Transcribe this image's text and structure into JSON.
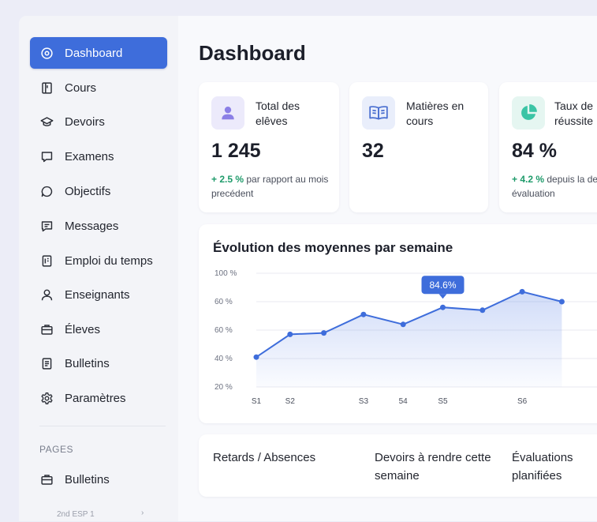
{
  "sidebar": {
    "items": [
      {
        "label": "Dashboard",
        "icon": "target-icon",
        "active": true
      },
      {
        "label": "Cours",
        "icon": "book-icon"
      },
      {
        "label": "Devoirs",
        "icon": "graduation-cap-icon"
      },
      {
        "label": "Examens",
        "icon": "chat-square-icon"
      },
      {
        "label": "Objectifs",
        "icon": "chat-bubble-icon"
      },
      {
        "label": "Messages",
        "icon": "message-icon"
      },
      {
        "label": "Emploi du temps",
        "icon": "calendar-doc-icon"
      },
      {
        "label": "Enseignants",
        "icon": "user-icon"
      },
      {
        "label": "Éleves",
        "icon": "briefcase-icon"
      },
      {
        "label": "Bulletins",
        "icon": "document-icon"
      },
      {
        "label": "Paramètres",
        "icon": "gear-icon"
      }
    ],
    "section_label": "PAGES",
    "section_items": [
      {
        "label": "Bulletins",
        "icon": "briefcase-icon"
      }
    ],
    "footer_text": "2nd ESP 1",
    "footer_chevron": "›",
    "accent": "#3e6ddb"
  },
  "main": {
    "title": "Dashboard",
    "stats": [
      {
        "label": "Total des elêves",
        "value": "1 245",
        "delta": "+ 2.5 %",
        "note": " par rapport au mois precédent",
        "icon": "user-icon",
        "icon_bg": "#eceafb",
        "icon_color": "#8b7fe6"
      },
      {
        "label": "Matières en cours",
        "value": "32",
        "delta": "",
        "note": "",
        "icon": "open-book-icon",
        "icon_bg": "#e9eefb",
        "icon_color": "#4a6fd0"
      },
      {
        "label": "Taux de réussite",
        "value": "84 %",
        "delta": "+ 4.2 %",
        "note": " depuis la derniere évaluation",
        "icon": "pie-chart-icon",
        "icon_bg": "#e5f6f1",
        "icon_color": "#3bc4a5"
      }
    ],
    "bottom": [
      {
        "label": "Retards / Absences"
      },
      {
        "label": "Devoirs à rendre cette semaine"
      },
      {
        "label": "Évaluations planifiées"
      }
    ]
  },
  "chart_data": {
    "type": "area",
    "title": "Évolution des moyennes par semaine",
    "x_labels": [
      "S1",
      "S2",
      "S3",
      "54",
      "S5",
      "S6"
    ],
    "y_ticks": [
      "100 %",
      "60 %",
      "60 %",
      "40 %",
      "20 %"
    ],
    "ylim": [
      20,
      100
    ],
    "points": [
      41,
      57,
      58,
      71,
      64,
      76,
      74,
      87,
      80
    ],
    "highlight": {
      "index": 5,
      "label": "84.6%"
    },
    "line_color": "#3e6ddb",
    "grid": true
  }
}
